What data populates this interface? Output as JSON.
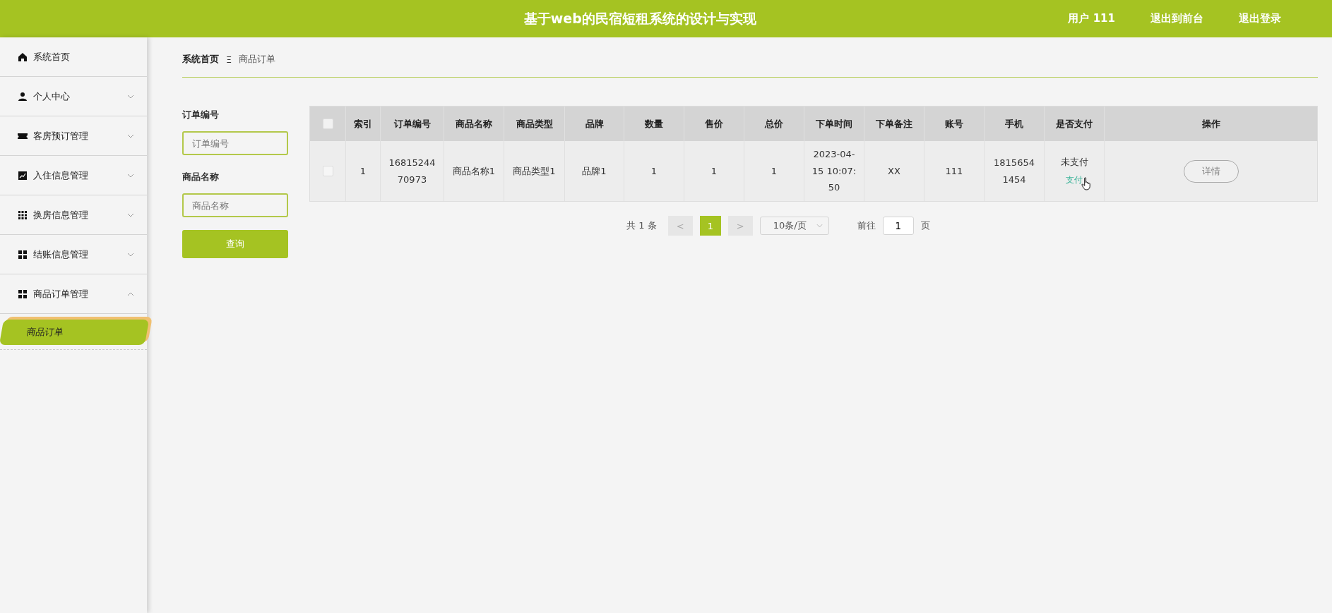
{
  "header": {
    "title": "基于web的民宿短租系统的设计与实现",
    "user": "用户 111",
    "links": [
      "退出到前台",
      "退出登录"
    ]
  },
  "sidebar": {
    "items": [
      {
        "label": "系统首页"
      },
      {
        "label": "个人中心",
        "expanded": false
      },
      {
        "label": "客房预订管理",
        "expanded": false
      },
      {
        "label": "入住信息管理",
        "expanded": false
      },
      {
        "label": "换房信息管理",
        "expanded": false
      },
      {
        "label": "结账信息管理",
        "expanded": false
      },
      {
        "label": "商品订单管理",
        "expanded": true,
        "children": [
          {
            "label": "商品订单",
            "selected": true
          }
        ]
      }
    ]
  },
  "breadcrumb": {
    "home": "系统首页",
    "separator": "Ξ",
    "current": "商品订单"
  },
  "search": {
    "fields": [
      {
        "label": "订单编号",
        "placeholder": "订单编号"
      },
      {
        "label": "商品名称",
        "placeholder": "商品名称"
      }
    ],
    "button": "查询"
  },
  "table": {
    "select_all": {
      "checked": false
    },
    "columns": [
      "索引",
      "订单编号",
      "商品名称",
      "商品类型",
      "品牌",
      "数量",
      "售价",
      "总价",
      "下单时间",
      "下单备注",
      "账号",
      "手机",
      "是否支付",
      "操作"
    ],
    "rows": [
      {
        "checked": false,
        "cells": [
          "1",
          "1681524470973",
          "商品名称1",
          "商品类型1",
          "品牌1",
          "1",
          "1",
          "1",
          "2023-04-15 10:07:50",
          "XX",
          "111",
          "18156541454"
        ],
        "pay_status": "未支付",
        "pay_link": "支付",
        "action": "详情"
      }
    ]
  },
  "pagination": {
    "total": "共 1 条",
    "prev": "<",
    "pages": [
      {
        "label": "1",
        "selected": true
      }
    ],
    "next": ">",
    "page_size": "10条/页",
    "goto_label": "前往",
    "goto_value": "1",
    "goto_suffix": "页"
  }
}
